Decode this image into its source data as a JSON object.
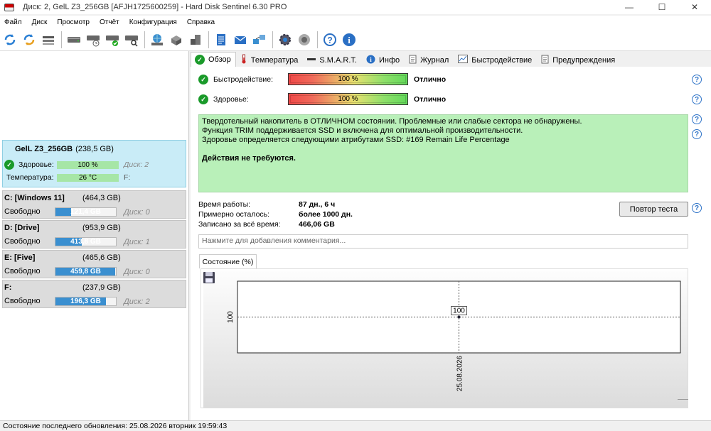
{
  "window": {
    "title": "Диск: 2, GelL Z3_256GB [AFJH1725600259]  -  Hard Disk Sentinel 6.30 PRO",
    "minimize": "—",
    "maximize": "☐",
    "close": "✕"
  },
  "menu": [
    "Файл",
    "Диск",
    "Просмотр",
    "Отчёт",
    "Конфигурация",
    "Справка"
  ],
  "toolbar_icons": [
    "refresh-icon",
    "refresh-all-icon",
    "disk-list-icon",
    "disk-icon",
    "disk-timer-icon",
    "disk-check-icon",
    "disk-search-icon",
    "network-disk-icon",
    "server-icon",
    "disk-transfer-icon",
    "report-icon",
    "email-icon",
    "network-icon",
    "settings-icon",
    "sound-icon",
    "help-icon",
    "info-icon"
  ],
  "disk": {
    "name": "GelL Z3_256GB",
    "size": "(238,5 GB)",
    "health_label": "Здоровье:",
    "health_value": "100 %",
    "health_fraction": 1.0,
    "disk_number": "Диск: 2",
    "temp_label": "Температура:",
    "temp_value": "26 °C",
    "drive_letter": "F:"
  },
  "partitions": [
    {
      "name": "C: [Windows 11]",
      "size": "(464,3 GB)",
      "free_label": "Свободно",
      "free": "121,4 GB",
      "free_fraction": 0.26,
      "disk": "Диск: 0"
    },
    {
      "name": "D: [Drive]",
      "size": "(953,9 GB)",
      "free_label": "Свободно",
      "free": "413,8 GB",
      "free_fraction": 0.43,
      "disk": "Диск: 1"
    },
    {
      "name": "E: [Five]",
      "size": "(465,6 GB)",
      "free_label": "Свободно",
      "free": "459,8 GB",
      "free_fraction": 0.99,
      "disk": "Диск: 0"
    },
    {
      "name": "F:",
      "size": "(237,9 GB)",
      "free_label": "Свободно",
      "free": "196,3 GB",
      "free_fraction": 0.83,
      "disk": "Диск: 2"
    }
  ],
  "tabs": [
    {
      "label": "Обзор",
      "icon": "check-icon",
      "active": true
    },
    {
      "label": "Температура",
      "icon": "thermometer-icon"
    },
    {
      "label": "S.M.A.R.T.",
      "icon": "smart-icon"
    },
    {
      "label": "Инфо",
      "icon": "info-icon"
    },
    {
      "label": "Журнал",
      "icon": "log-icon"
    },
    {
      "label": "Быстродействие",
      "icon": "chart-icon"
    },
    {
      "label": "Предупреждения",
      "icon": "alert-icon"
    }
  ],
  "overview": {
    "performance_label": "Быстродействие:",
    "performance_value": "100 %",
    "performance_rating": "Отлично",
    "health_label": "Здоровье:",
    "health_value": "100 %",
    "health_rating": "Отлично",
    "message_lines": [
      "Твердотельный накопитель в ОТЛИЧНОМ состоянии. Проблемные или слабые сектора не обнаружены.",
      "Функция TRIM поддерживается SSD и включена для оптимальной производительности.",
      "Здоровье определяется следующими атрибутами SSD: #169 Remain Life Percentage"
    ],
    "message_action": "Действия не требуются.",
    "uptime_label": "Время работы:",
    "uptime_value": "87 дн., 6 ч",
    "remaining_label": "Примерно осталось:",
    "remaining_value": "более 1000 дн.",
    "written_label": "Записано за всё время:",
    "written_value": "466,06 GB",
    "retest_button": "Повтор теста",
    "comment_placeholder": "Нажмите для добавления комментария..."
  },
  "chart_tab_label": "Состояние (%)",
  "chart_data": {
    "type": "line",
    "x": [
      "25.08.2026"
    ],
    "y": [
      100
    ],
    "point_labels": [
      "100"
    ],
    "ytick_labels": [
      "100"
    ],
    "xtick_labels": [
      "25.08.2026"
    ]
  },
  "status": {
    "text": "Состояние последнего обновления: 25.08.2026 вторник 19:59:43"
  }
}
